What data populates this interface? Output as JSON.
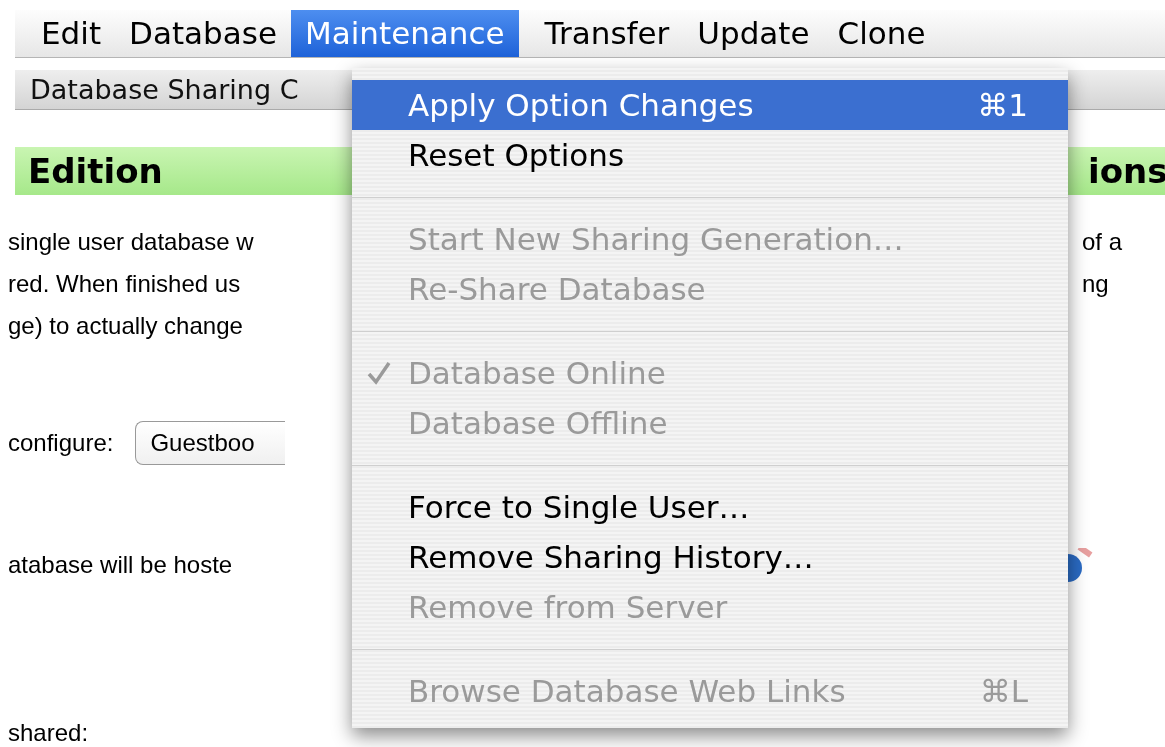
{
  "menu_bar": [
    {
      "label": "Edit",
      "selected": false
    },
    {
      "label": "Database",
      "selected": false
    },
    {
      "label": "Maintenance",
      "selected": true
    },
    {
      "label": "Transfer",
      "selected": false
    },
    {
      "label": "Update",
      "selected": false
    },
    {
      "label": "Clone",
      "selected": false
    }
  ],
  "toolbar": {
    "title": "Database Sharing C"
  },
  "header": {
    "title": "Edition",
    "title_right": "ions"
  },
  "description": [
    {
      "left": "single user database w",
      "right": "of a"
    },
    {
      "left": "red. When finished us",
      "right": "ng"
    },
    {
      "left": "ge) to actually change"
    }
  ],
  "configure": {
    "label": "configure:",
    "value": "Guestboo"
  },
  "hosted": {
    "label": "atabase will be hoste"
  },
  "shared": {
    "label": "shared:"
  },
  "menu": [
    {
      "kind": "item",
      "label": "Apply Option Changes",
      "shortcut": "⌘1",
      "selected": true,
      "disabled": false,
      "checked": false
    },
    {
      "kind": "item",
      "label": "Reset Options",
      "selected": false,
      "disabled": false,
      "checked": false
    },
    {
      "kind": "separator"
    },
    {
      "kind": "item",
      "label": "Start New Sharing Generation…",
      "selected": false,
      "disabled": true,
      "checked": false
    },
    {
      "kind": "item",
      "label": "Re-Share Database",
      "selected": false,
      "disabled": true,
      "checked": false
    },
    {
      "kind": "separator"
    },
    {
      "kind": "item",
      "label": "Database Online",
      "selected": false,
      "disabled": true,
      "checked": true
    },
    {
      "kind": "item",
      "label": "Database Offline",
      "selected": false,
      "disabled": true,
      "checked": false
    },
    {
      "kind": "separator"
    },
    {
      "kind": "item",
      "label": "Force to Single User…",
      "selected": false,
      "disabled": false,
      "checked": false
    },
    {
      "kind": "item",
      "label": "Remove Sharing History…",
      "selected": false,
      "disabled": false,
      "checked": false
    },
    {
      "kind": "item",
      "label": "Remove from Server",
      "selected": false,
      "disabled": true,
      "checked": false
    },
    {
      "kind": "separator"
    },
    {
      "kind": "item",
      "label": "Browse Database Web Links",
      "shortcut": "⌘L",
      "selected": false,
      "disabled": true,
      "checked": false
    }
  ]
}
